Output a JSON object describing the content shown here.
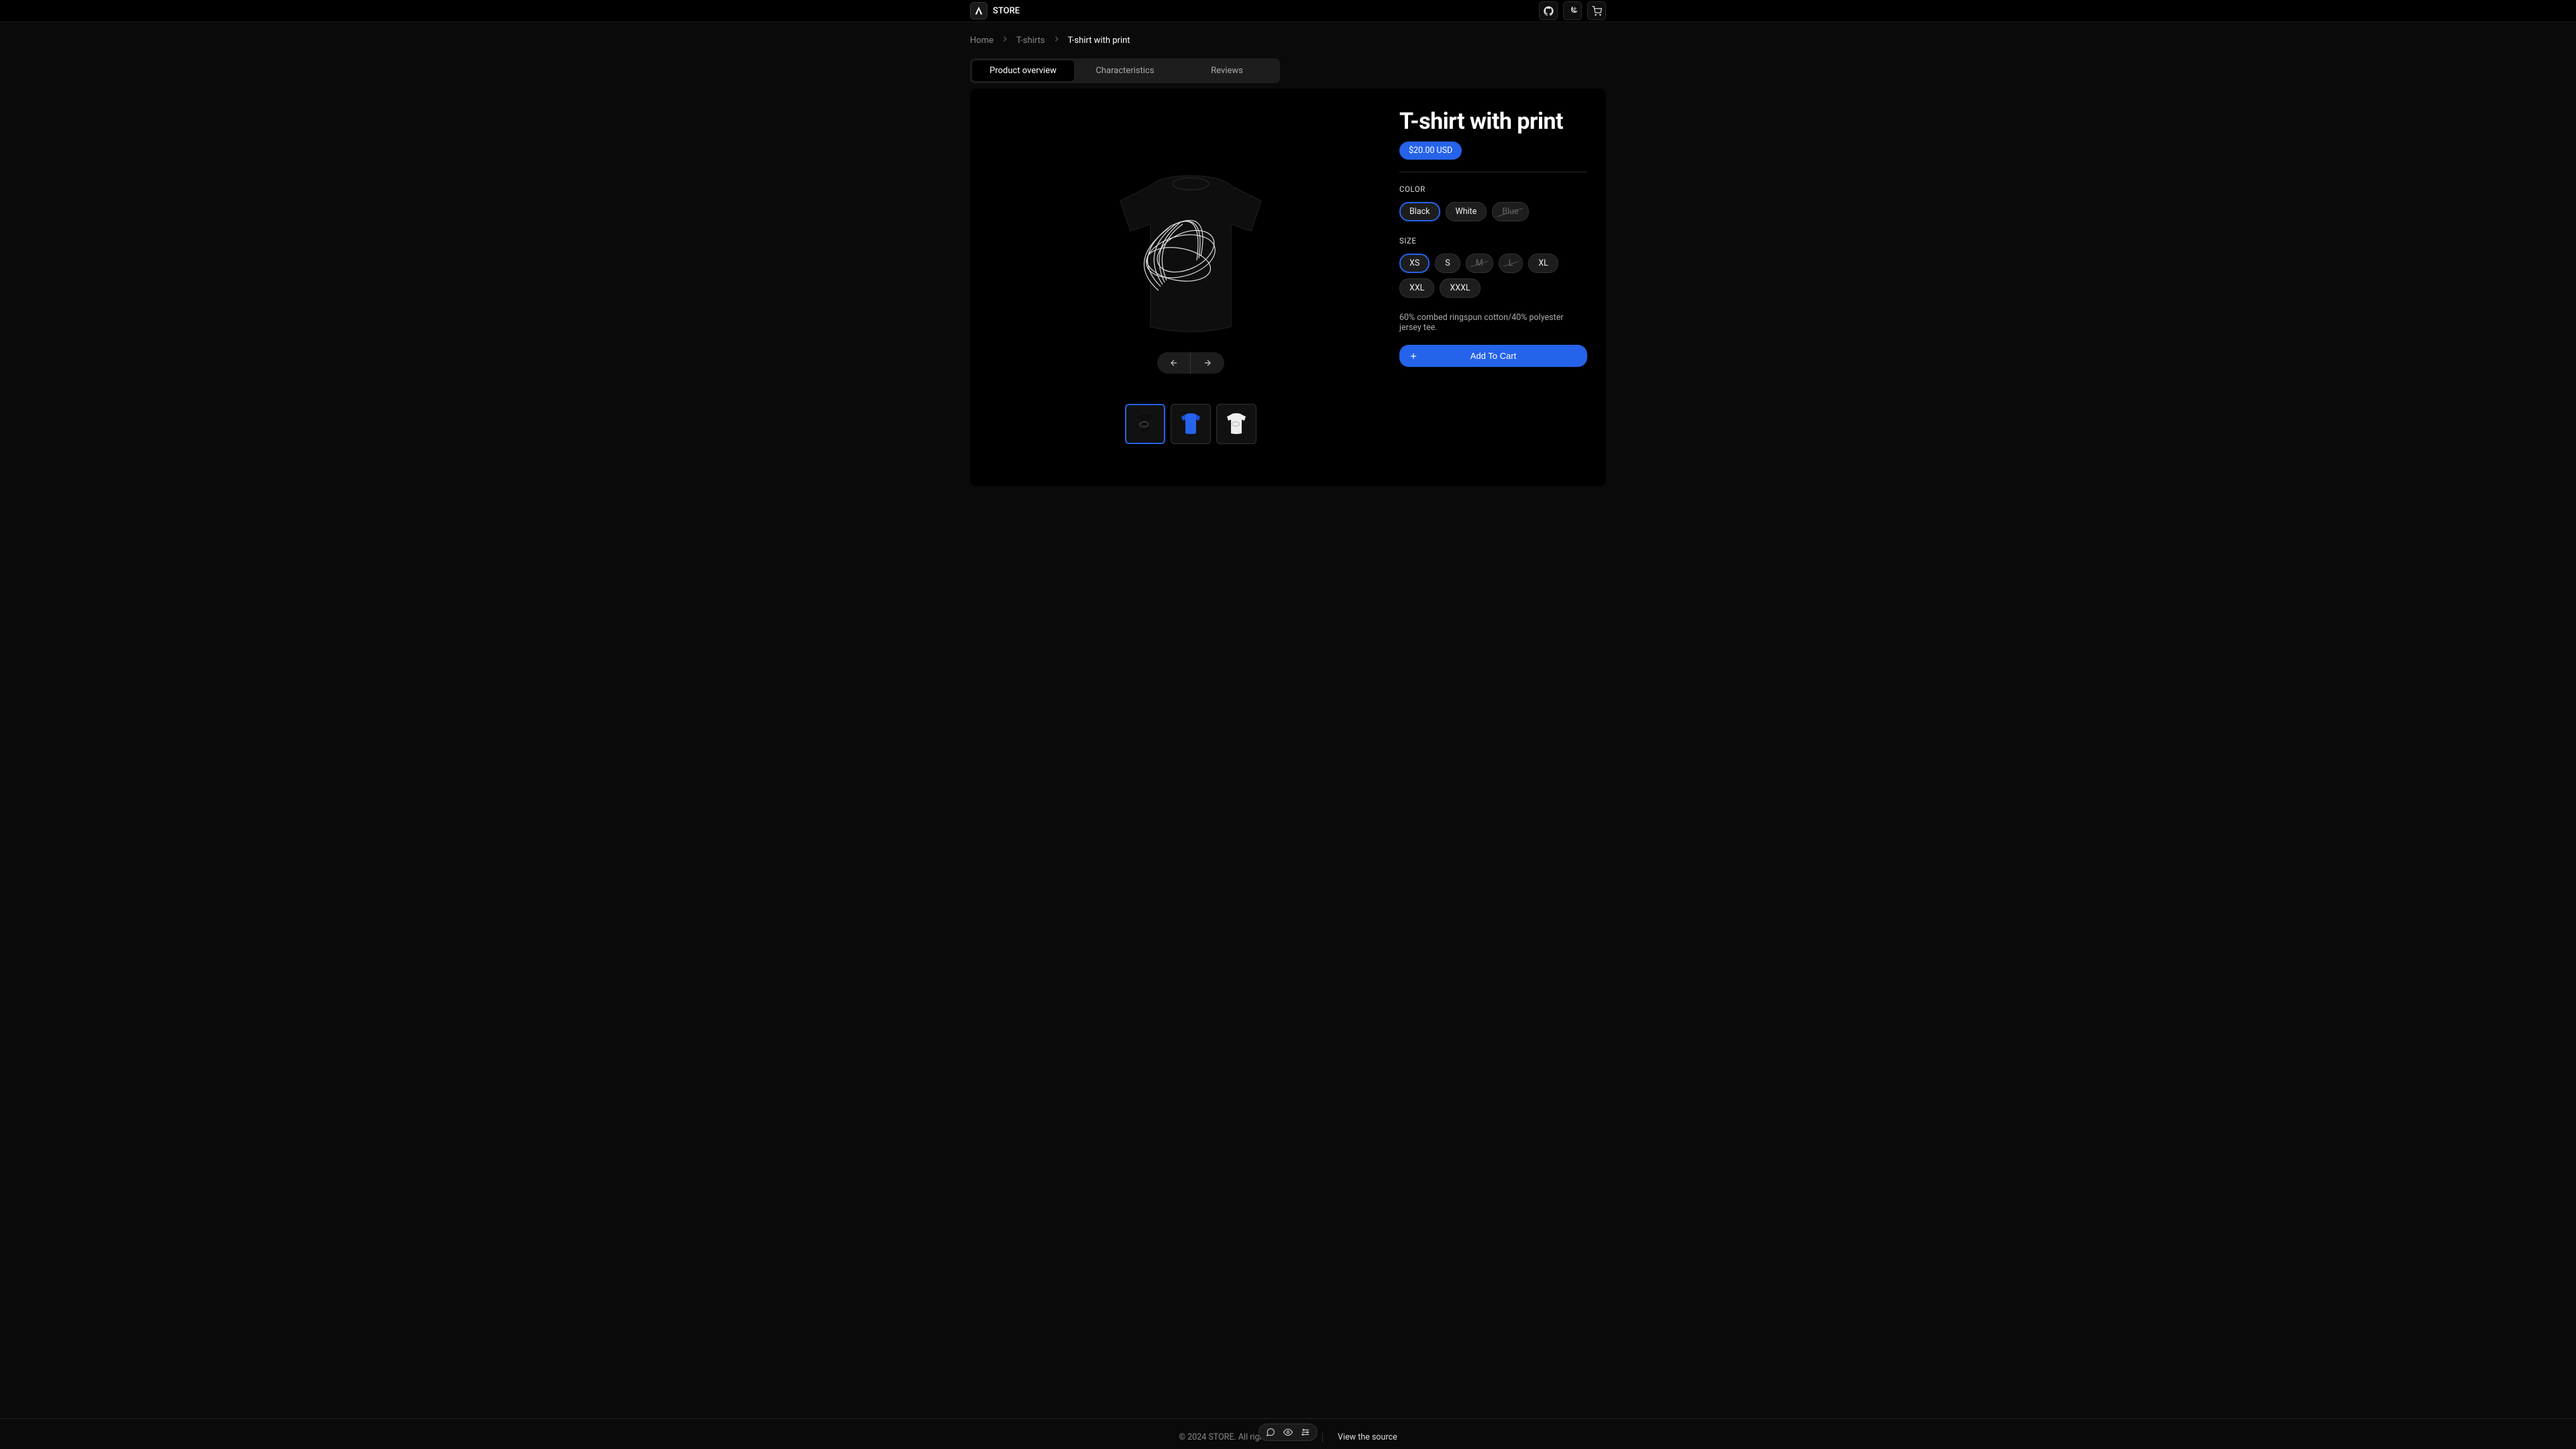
{
  "brand": "STORE",
  "breadcrumb": {
    "home": "Home",
    "cat": "T-shirts",
    "current": "T-shirt with print"
  },
  "tabs": {
    "overview": "Product overview",
    "chars": "Characteristics",
    "reviews": "Reviews"
  },
  "product": {
    "title": "T-shirt with print",
    "price": "$20.00 USD",
    "color_label": "COLOR",
    "colors": {
      "black": "Black",
      "white": "White",
      "blue": "Blue"
    },
    "size_label": "SIZE",
    "sizes": {
      "xs": "XS",
      "s": "S",
      "m": "M",
      "l": "L",
      "xl": "XL",
      "xxl": "XXL",
      "xxxl": "XXXL"
    },
    "desc": "60% combed ringspun cotton/40% polyester jersey tee.",
    "add_to_cart": "Add To Cart"
  },
  "footer": {
    "copyright": "© 2024 STORE. All rights reserved.",
    "source": "View the source"
  }
}
